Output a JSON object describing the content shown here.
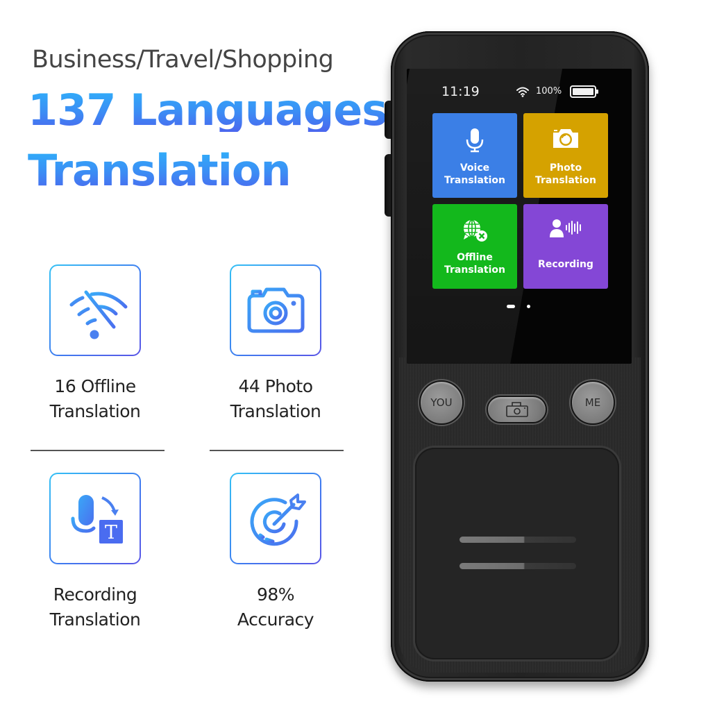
{
  "header": {
    "subtitle": "Business/Travel/Shopping",
    "headline_line1": "137 Languages",
    "headline_line2": "Translation"
  },
  "features": [
    {
      "icon": "wifi-off-icon",
      "line1": "16 Offline",
      "line2": "Translation"
    },
    {
      "icon": "camera-icon",
      "line1": "44 Photo",
      "line2": "Translation"
    },
    {
      "icon": "mic-to-text-icon",
      "line1": "Recording",
      "line2": "Translation"
    },
    {
      "icon": "target-icon",
      "line1": "98%",
      "line2": "Accuracy"
    }
  ],
  "device": {
    "status_bar": {
      "time": "11:19",
      "battery_text": "100%",
      "battery_level": 1.0,
      "wifi_icon": "wifi-icon"
    },
    "tiles": [
      {
        "icon": "microphone-icon",
        "line1": "Voice",
        "line2": "Translation",
        "color": "#3b7fe6"
      },
      {
        "icon": "camera-icon",
        "line1": "Photo",
        "line2": "Translation",
        "color": "#d5a200"
      },
      {
        "icon": "globe-offline-icon",
        "line1": "Offline",
        "line2": "Translation",
        "color": "#13b81c"
      },
      {
        "icon": "recording-icon",
        "line1": "Recording",
        "line2": "",
        "color": "#8447d6"
      }
    ],
    "pager": {
      "pages": 2,
      "current": 1
    },
    "buttons": {
      "you": "YOU",
      "me": "ME",
      "camera_icon": "camera-icon"
    }
  },
  "colors": {
    "accent_light": "#2fb0fa",
    "accent_dark": "#4b66ee",
    "text_dark": "#222222"
  }
}
